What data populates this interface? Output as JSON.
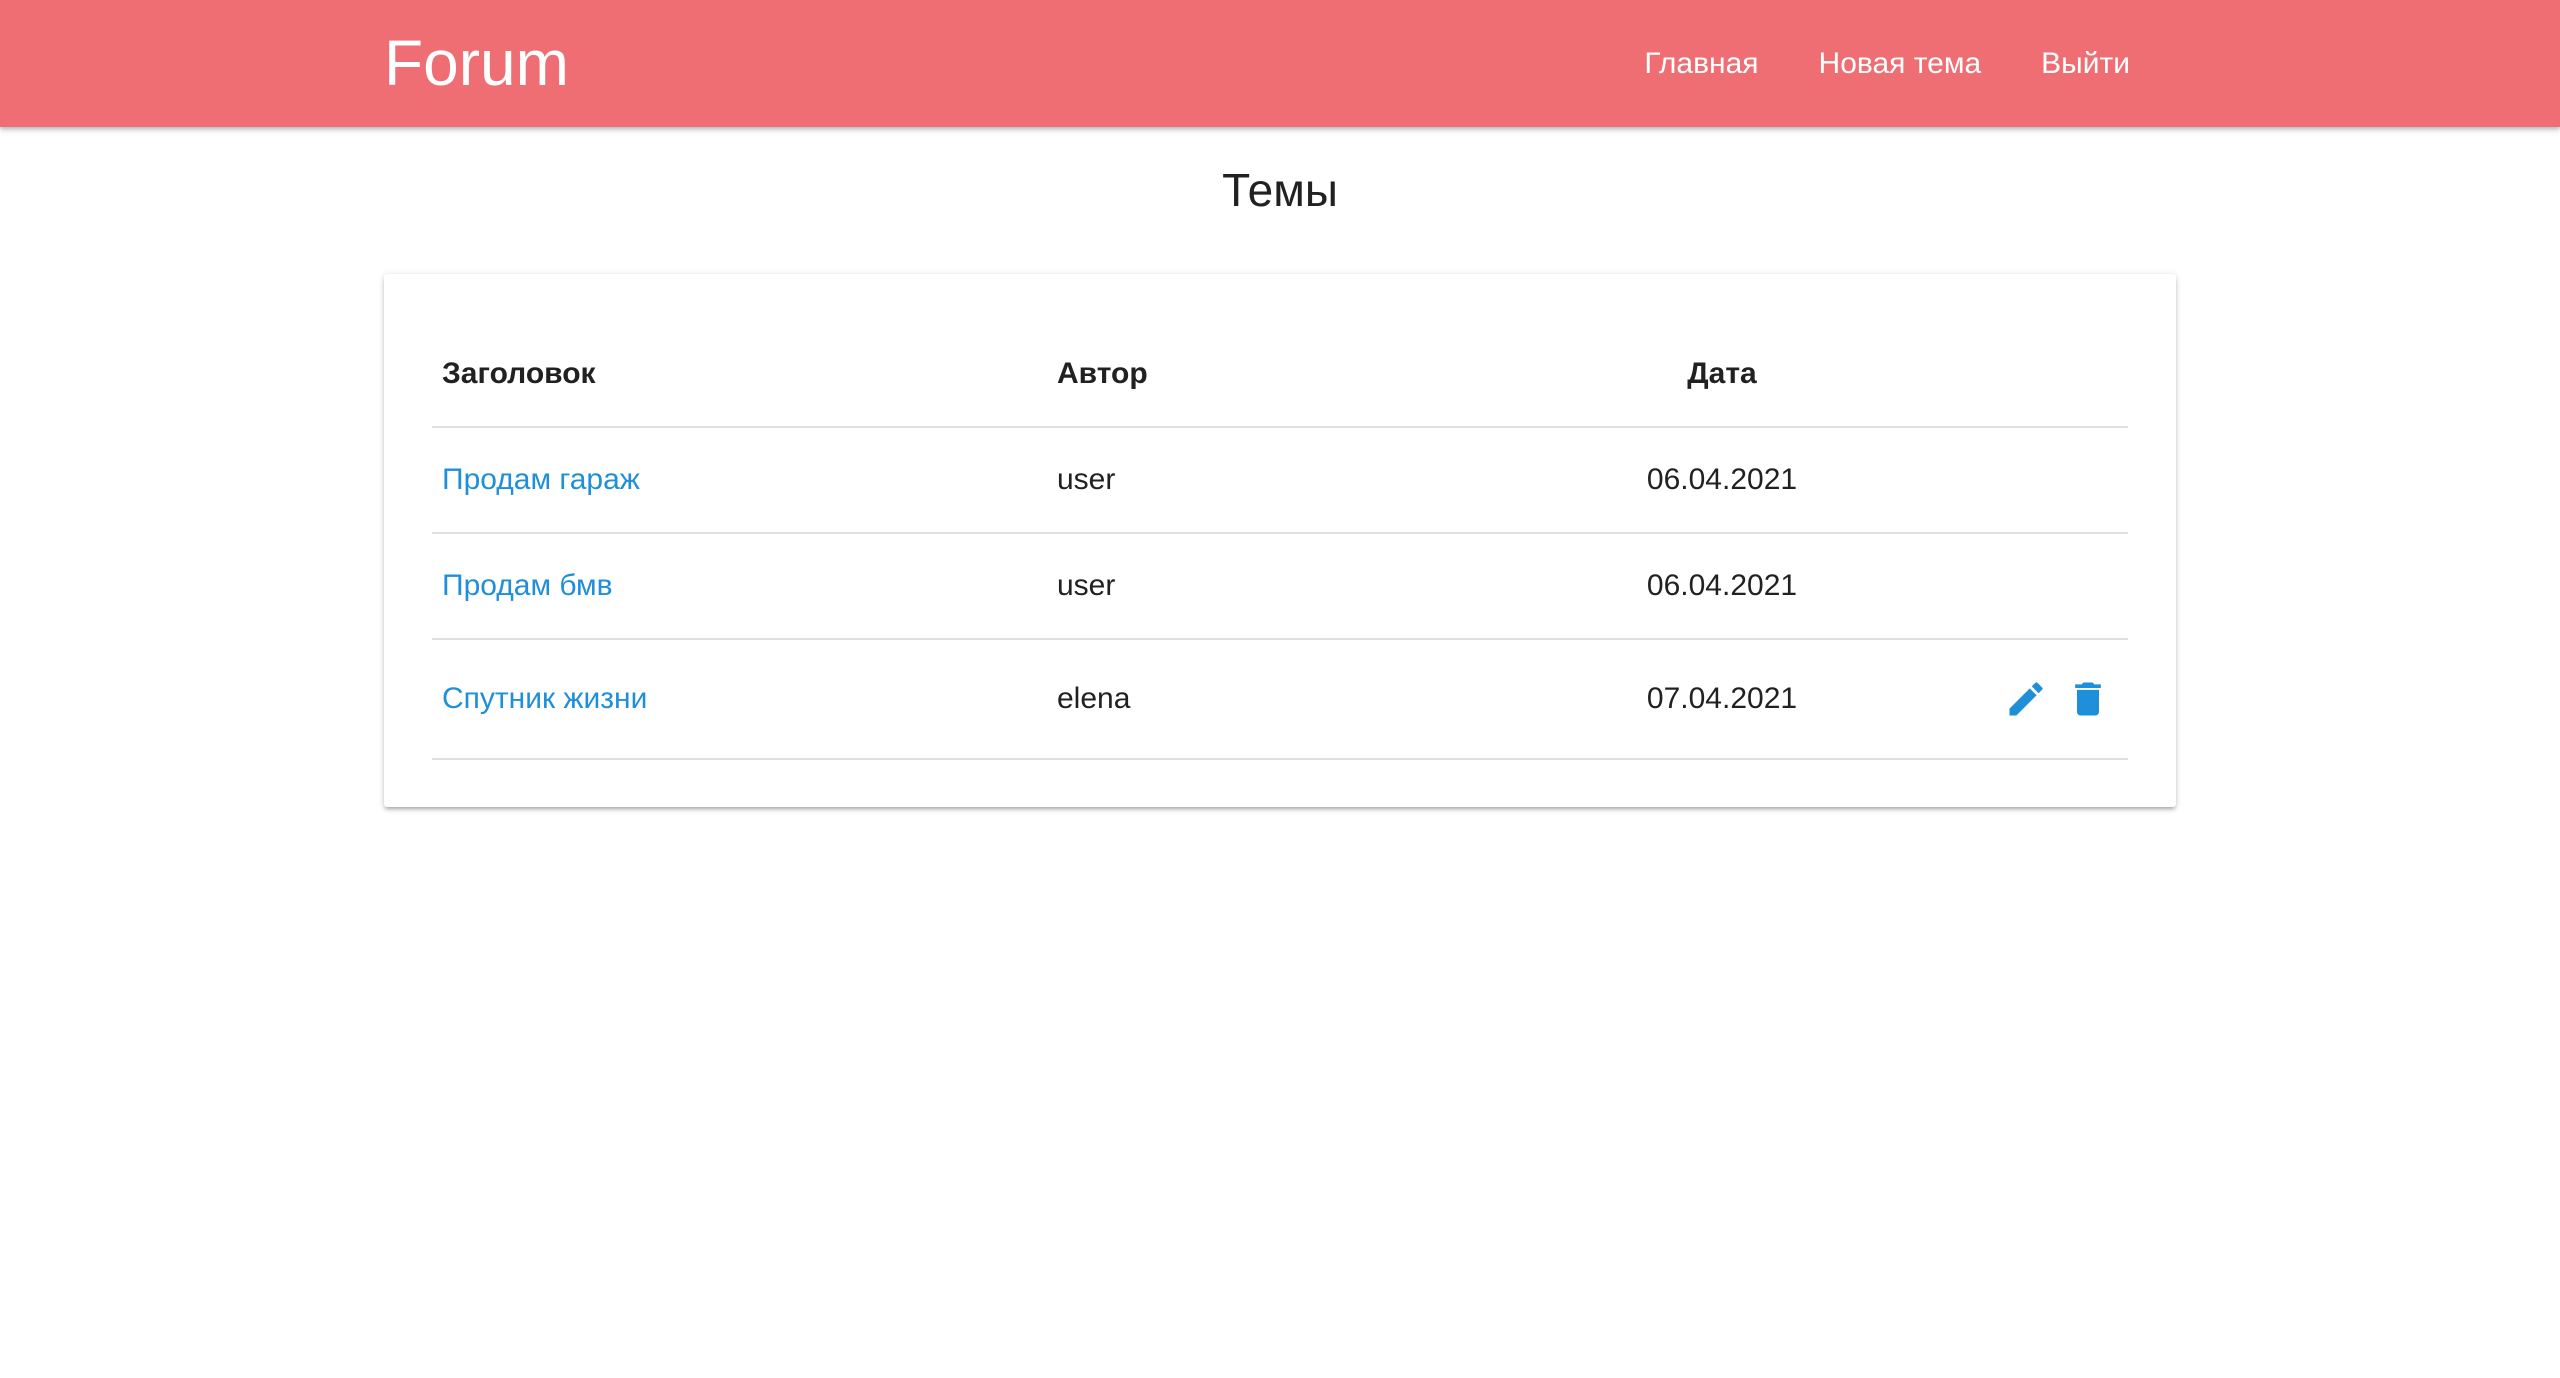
{
  "navbar": {
    "brand": "Forum",
    "links": [
      {
        "label": "Главная"
      },
      {
        "label": "Новая тема"
      },
      {
        "label": "Выйти"
      }
    ],
    "color": "#ee6e73"
  },
  "page": {
    "title": "Темы"
  },
  "table": {
    "headers": {
      "title": "Заголовок",
      "author": "Автор",
      "date": "Дата"
    },
    "rows": [
      {
        "title": "Продам гараж",
        "author": "user",
        "date": "06.04.2021",
        "actions": []
      },
      {
        "title": "Продам бмв",
        "author": "user",
        "date": "06.04.2021",
        "actions": []
      },
      {
        "title": "Спутник жизни",
        "author": "elena",
        "date": "07.04.2021",
        "actions": [
          "pencil-icon",
          "trash-icon"
        ]
      }
    ]
  },
  "colors": {
    "link": "#1e8fd8",
    "icon": "#1e8fd8"
  }
}
